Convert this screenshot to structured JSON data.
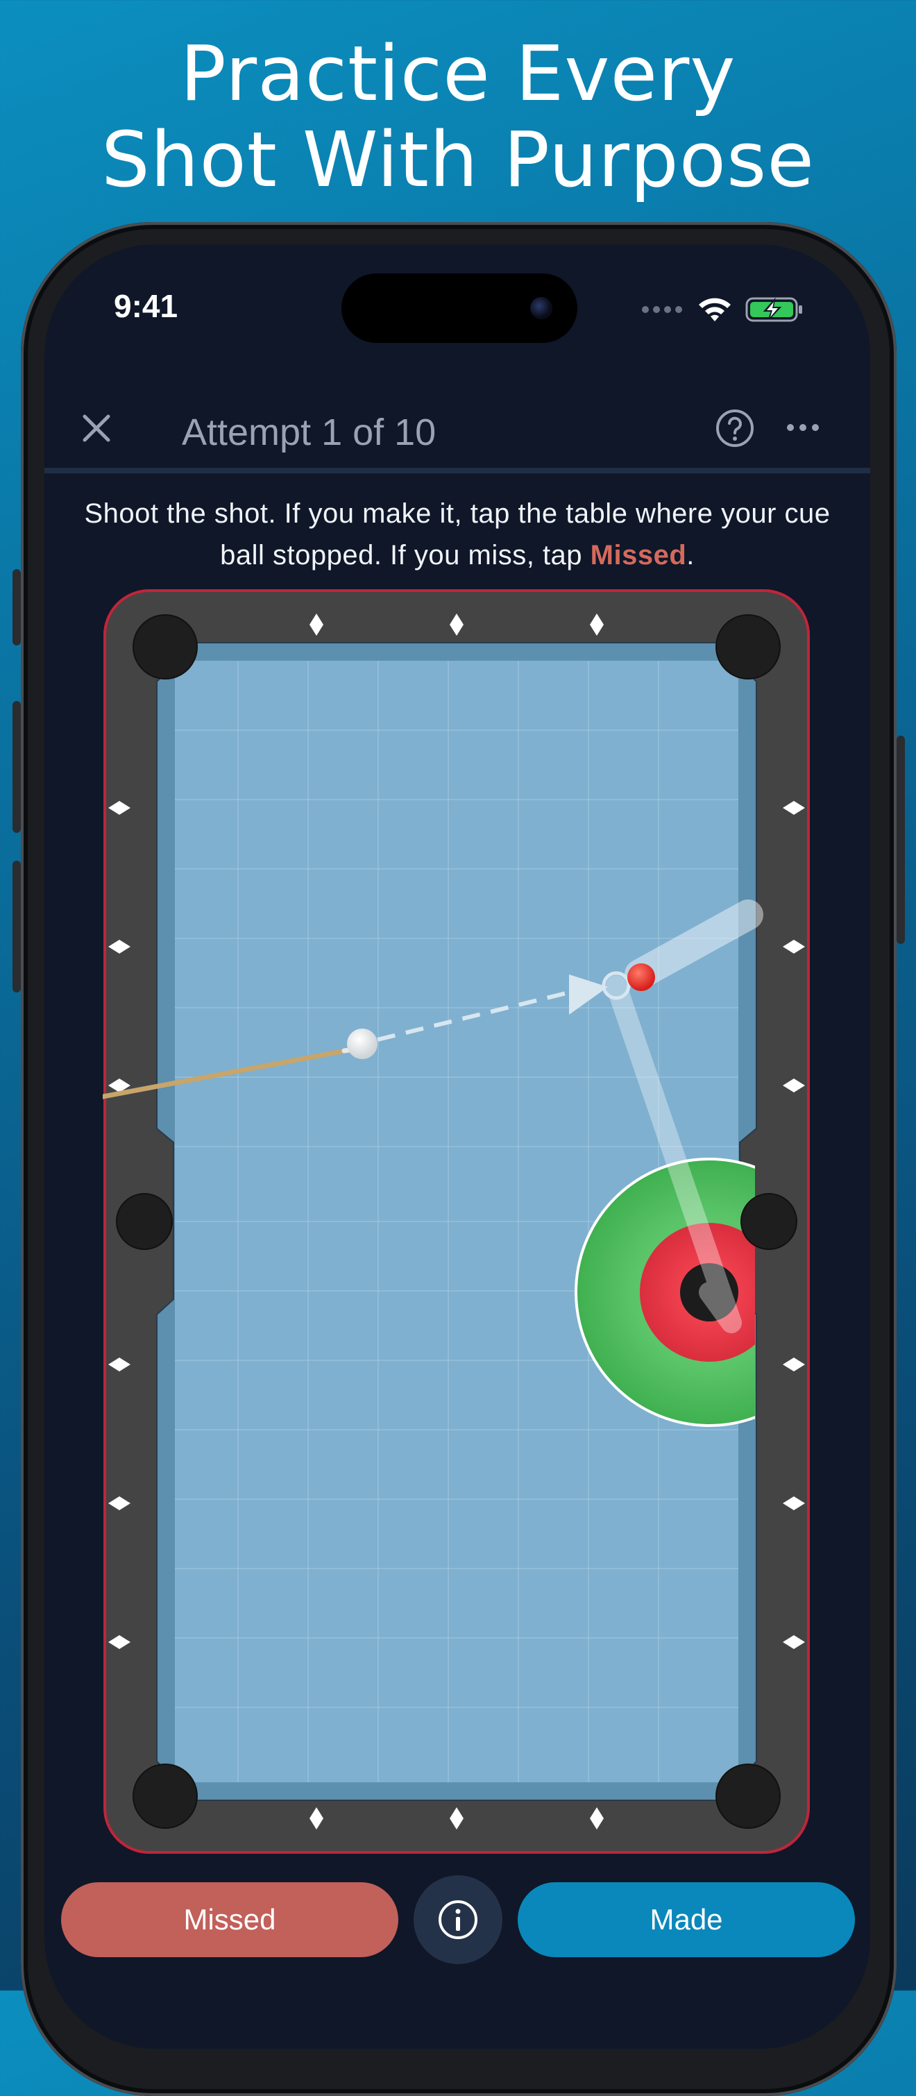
{
  "headline": {
    "line1": "Practice Every",
    "line2": "Shot With Purpose"
  },
  "status_bar": {
    "time": "9:41"
  },
  "header": {
    "title": "Attempt 1 of 10"
  },
  "instruction": {
    "before": "Shoot the shot. If you make it, tap the table where your cue ball stopped. If you miss, tap ",
    "highlight": "Missed",
    "after": "."
  },
  "actions": {
    "missed_label": "Missed",
    "made_label": "Made"
  },
  "icons": {
    "close": "close-icon",
    "help": "help-icon",
    "more": "more-icon",
    "info": "info-icon",
    "wifi": "wifi-icon",
    "battery": "battery-charging-icon"
  },
  "colors": {
    "background_top": "#0b8fbf",
    "screen_bg": "#0f1729",
    "accent_missed": "#c2605a",
    "accent_made": "#0a88bb",
    "table_felt": "#7fb0cf",
    "table_rail": "#444444",
    "table_border": "#c0253a",
    "target_outer": "#4fbe5e",
    "target_inner": "#e6394a",
    "object_ball": "#e0251f"
  }
}
